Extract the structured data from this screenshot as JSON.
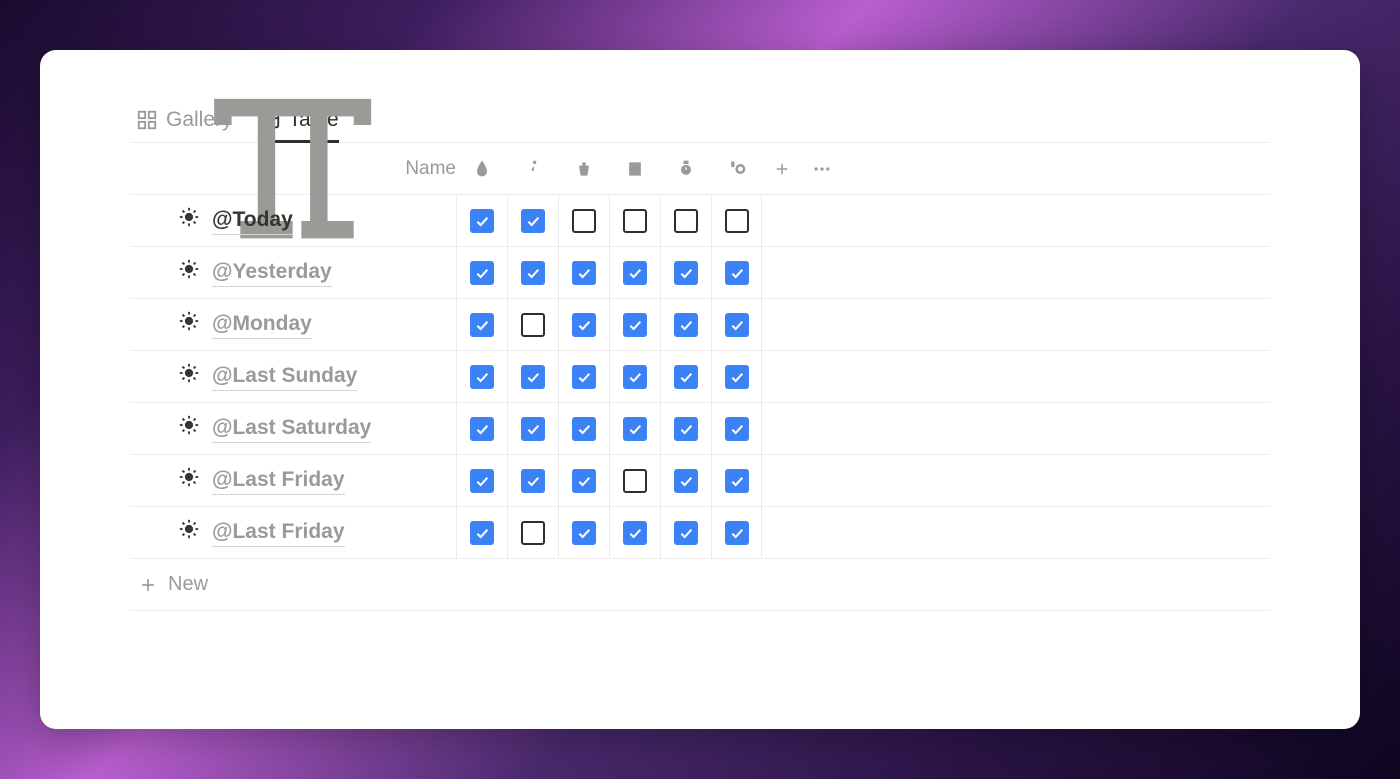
{
  "tabs": [
    {
      "label": "Gallery",
      "active": false
    },
    {
      "label": "Table",
      "active": true
    }
  ],
  "name_column_label": "Name",
  "column_icons": [
    "water-drop",
    "running",
    "cup",
    "book",
    "watch",
    "food"
  ],
  "rows": [
    {
      "emoji": "sun",
      "date": "@Today",
      "is_today": true,
      "checks": [
        true,
        true,
        false,
        false,
        false,
        false
      ]
    },
    {
      "emoji": "sun",
      "date": "@Yesterday",
      "is_today": false,
      "checks": [
        true,
        true,
        true,
        true,
        true,
        true
      ]
    },
    {
      "emoji": "sun",
      "date": "@Monday",
      "is_today": false,
      "checks": [
        true,
        false,
        true,
        true,
        true,
        true
      ]
    },
    {
      "emoji": "sun",
      "date": "@Last Sunday",
      "is_today": false,
      "checks": [
        true,
        true,
        true,
        true,
        true,
        true
      ]
    },
    {
      "emoji": "sun",
      "date": "@Last Saturday",
      "is_today": false,
      "checks": [
        true,
        true,
        true,
        true,
        true,
        true
      ]
    },
    {
      "emoji": "sun",
      "date": "@Last Friday",
      "is_today": false,
      "checks": [
        true,
        true,
        true,
        false,
        true,
        true
      ]
    },
    {
      "emoji": "sun",
      "date": "@Last Friday",
      "is_today": false,
      "checks": [
        true,
        false,
        true,
        true,
        true,
        true
      ]
    }
  ],
  "new_row_label": "New"
}
